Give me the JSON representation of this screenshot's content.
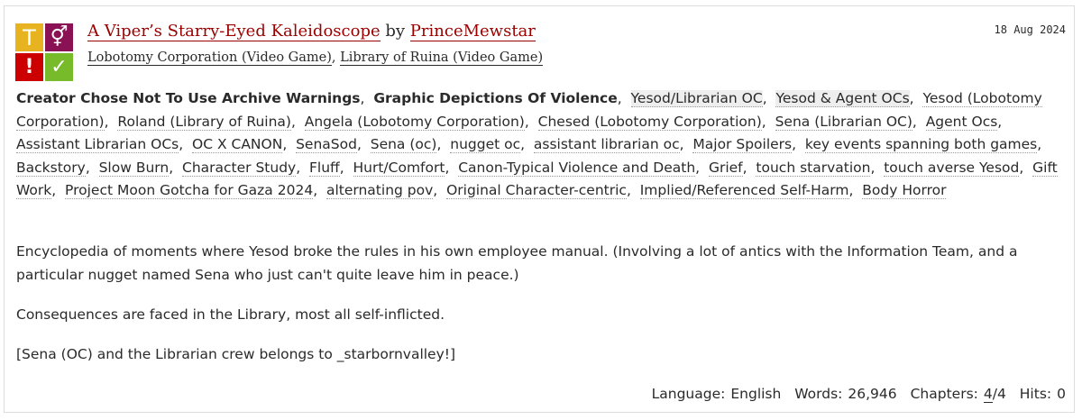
{
  "work": {
    "title": "A Viper’s Starry-Eyed Kaleidoscope",
    "by": "by",
    "author": "PrinceMewstar",
    "date": "18 Aug 2024",
    "icons": {
      "rating": "T",
      "category": "⚥",
      "warning": "!",
      "complete": "✓"
    },
    "fandoms": [
      "Lobotomy Corporation (Video Game)",
      "Library of Ruina (Video Game)"
    ],
    "warnings": [
      "Creator Chose Not To Use Archive Warnings",
      "Graphic Depictions Of Violence"
    ],
    "relationships": [
      "Yesod/Librarian OC",
      "Yesod & Agent OCs"
    ],
    "characters": [
      "Yesod (Lobotomy Corporation)",
      "Roland (Library of Ruina)",
      "Angela (Lobotomy Corporation)",
      "Chesed (Lobotomy Corporation)",
      "Sena (Librarian OC)",
      "Agent Ocs",
      "Assistant Librarian OCs"
    ],
    "freeforms": [
      "OC X CANON",
      "SenaSod",
      "Sena (oc)",
      "nugget oc",
      "assistant librarian oc",
      "Major Spoilers",
      "key events spanning both games",
      "Backstory",
      "Slow Burn",
      "Character Study",
      "Fluff",
      "Hurt/Comfort",
      "Canon-Typical Violence and Death",
      "Grief",
      "touch starvation",
      "touch averse Yesod",
      "Gift Work",
      "Project Moon Gotcha for Gaza 2024",
      "alternating pov",
      "Original Character-centric",
      "Implied/Referenced Self-Harm",
      "Body Horror"
    ],
    "summary": [
      "Encyclopedia of moments where Yesod broke the rules in his own employee manual. (Involving a lot of antics with the Information Team, and a particular nugget named Sena who just can't quite leave him in peace.)",
      "Consequences are faced in the Library, most all self-inflicted.",
      "[Sena (OC) and the Librarian crew belongs to _starbornvalley!]"
    ],
    "stats": {
      "language_label": "Language:",
      "language": "English",
      "words_label": "Words:",
      "words": "26,946",
      "chapters_label": "Chapters:",
      "chapters_posted": "4",
      "chapters_total": "/4",
      "hits_label": "Hits:",
      "hits": "0"
    }
  }
}
